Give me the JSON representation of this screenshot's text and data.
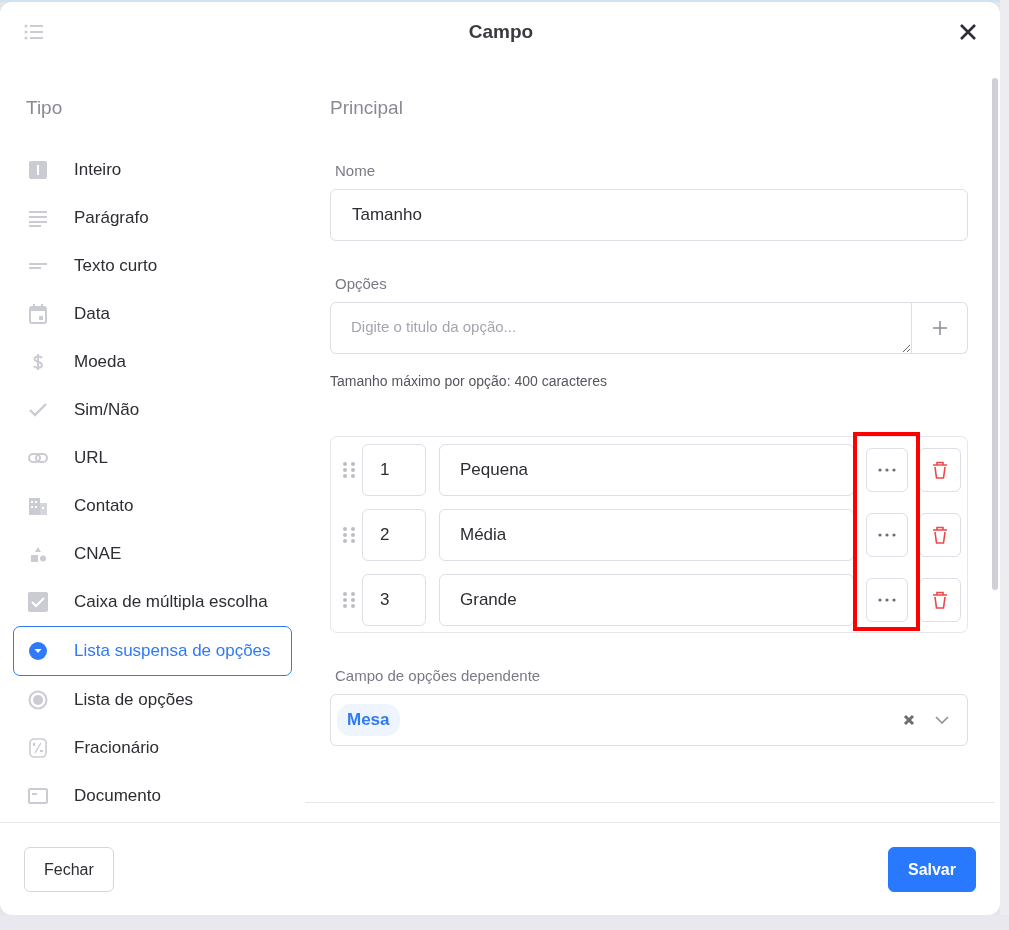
{
  "header": {
    "title": "Campo"
  },
  "sidebar": {
    "heading": "Tipo",
    "items": [
      {
        "label": "Inteiro",
        "kind": "integer",
        "selected": false
      },
      {
        "label": "Parágrafo",
        "kind": "paragraph",
        "selected": false
      },
      {
        "label": "Texto curto",
        "kind": "short-text",
        "selected": false
      },
      {
        "label": "Data",
        "kind": "date",
        "selected": false
      },
      {
        "label": "Moeda",
        "kind": "currency",
        "selected": false
      },
      {
        "label": "Sim/Não",
        "kind": "yes-no",
        "selected": false
      },
      {
        "label": "URL",
        "kind": "url",
        "selected": false
      },
      {
        "label": "Contato",
        "kind": "contact",
        "selected": false
      },
      {
        "label": "CNAE",
        "kind": "cnae",
        "selected": false
      },
      {
        "label": "Caixa de múltipla escolha",
        "kind": "multi-choice",
        "selected": false
      },
      {
        "label": "Lista suspensa de opções",
        "kind": "dropdown",
        "selected": true
      },
      {
        "label": "Lista de opções",
        "kind": "radio",
        "selected": false
      },
      {
        "label": "Fracionário",
        "kind": "fraction",
        "selected": false
      },
      {
        "label": "Documento",
        "kind": "document",
        "selected": false
      }
    ]
  },
  "main": {
    "heading": "Principal",
    "name_field": {
      "label": "Nome",
      "value": "Tamanho"
    },
    "options_field": {
      "label": "Opções",
      "placeholder": "Digite o titulo da opção...",
      "hint": "Tamanho máximo por opção: 400 caracteres"
    },
    "options": [
      {
        "number": "1",
        "title": "Pequena"
      },
      {
        "number": "2",
        "title": "Média"
      },
      {
        "number": "3",
        "title": "Grande"
      }
    ],
    "dependent_field": {
      "label": "Campo de opções dependente",
      "tags": [
        "Mesa"
      ]
    }
  },
  "footer": {
    "buttons": [
      {
        "label": "Fechar",
        "kind": "secondary"
      },
      {
        "label": "Salvar",
        "kind": "primary"
      }
    ]
  }
}
